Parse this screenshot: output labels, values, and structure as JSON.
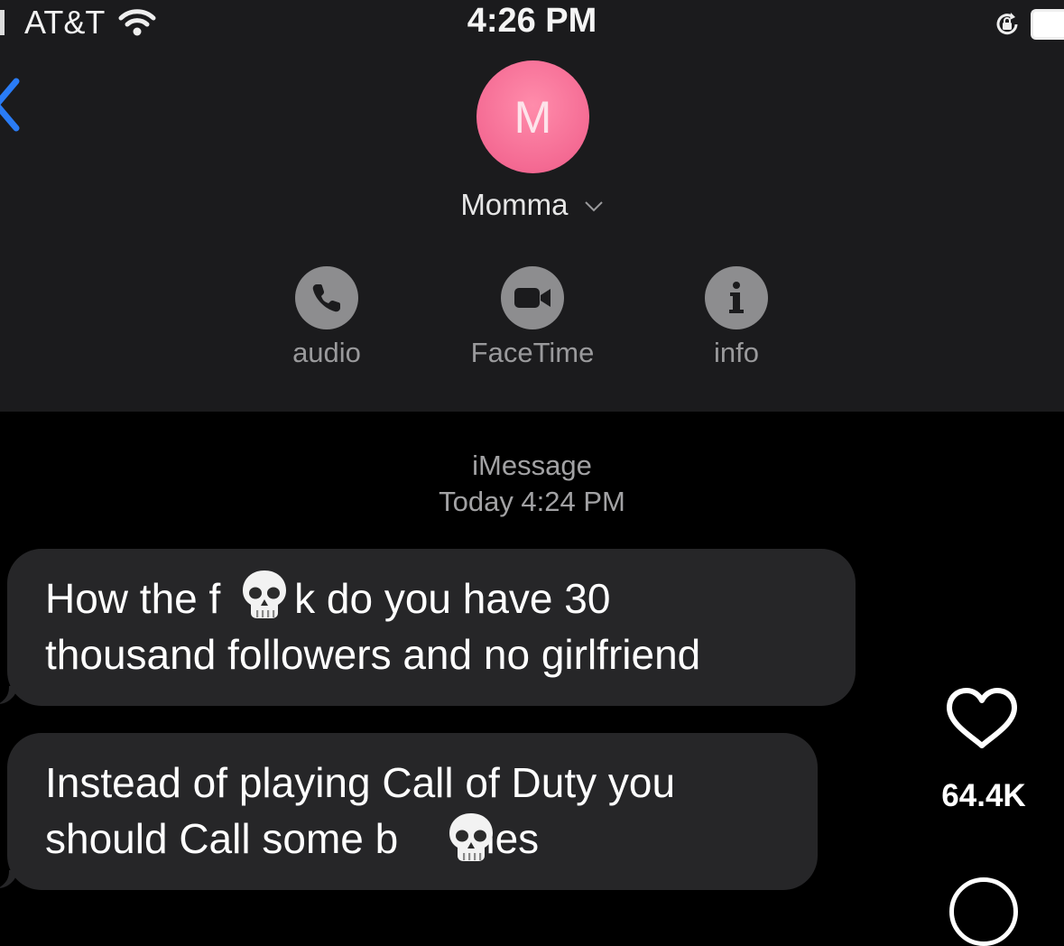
{
  "status_bar": {
    "carrier": "AT&T",
    "time": "4:26 PM",
    "icons": [
      "signal-icon",
      "wifi-icon",
      "rotation-lock-icon",
      "battery-icon"
    ]
  },
  "header": {
    "avatar_initial": "M",
    "avatar_color": "#f46a93",
    "contact_name": "Momma",
    "actions": [
      {
        "label": "audio",
        "icon": "phone-icon"
      },
      {
        "label": "FaceTime",
        "icon": "video-camera-icon"
      },
      {
        "label": "info",
        "icon": "info-icon"
      }
    ]
  },
  "conversation": {
    "service": "iMessage",
    "timestamp": "Today 4:24 PM",
    "messages": [
      {
        "line1": "How the f   k do you have 30",
        "line2": "thousand followers and no girlfriend",
        "emoji": "skull"
      },
      {
        "line1": "Instead of playing Call of Duty you",
        "line2": "should Call some b   hes",
        "emoji": "skull"
      }
    ]
  },
  "overlay": {
    "like_count": "64.4K",
    "icons": [
      "heart-icon",
      "comment-icon"
    ]
  },
  "colors": {
    "header_bg": "#1b1b1d",
    "bubble_bg": "#262628",
    "accent_blue": "#2a7cf6"
  }
}
